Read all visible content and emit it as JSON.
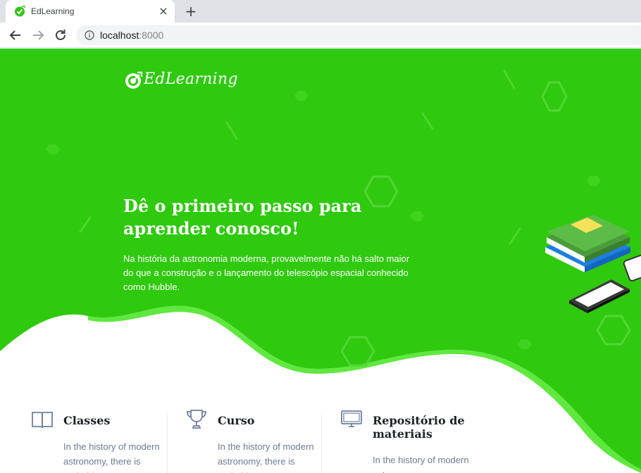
{
  "browser": {
    "tab_title": "EdLearning",
    "tab_close": "×",
    "new_tab": "+",
    "url_host": "localhost",
    "url_port": ":8000"
  },
  "header": {
    "logo_text": "EdLearning"
  },
  "hero": {
    "title": "Dê o primeiro passo para aprender conosco!",
    "text": "Na história da astronomia moderna, provavelmente não há salto maior do que a construção e o lançamento do telescópio espacial conhecido como Hubble."
  },
  "features": [
    {
      "title": "Classes",
      "text": "In the history of modern astronomy, there is probably",
      "icon": "book-icon"
    },
    {
      "title": "Curso",
      "text": "In the history of modern astronomy, there is probably",
      "icon": "trophy-icon"
    },
    {
      "title": "Repositório de materiais",
      "text": "In the history of modern astronomy",
      "icon": "monitor-icon"
    }
  ],
  "colors": {
    "brand_green": "#2ec70f",
    "brand_green_light": "#4cdd2b",
    "text_dark": "#1d2228",
    "text_muted": "#6c7a93"
  }
}
